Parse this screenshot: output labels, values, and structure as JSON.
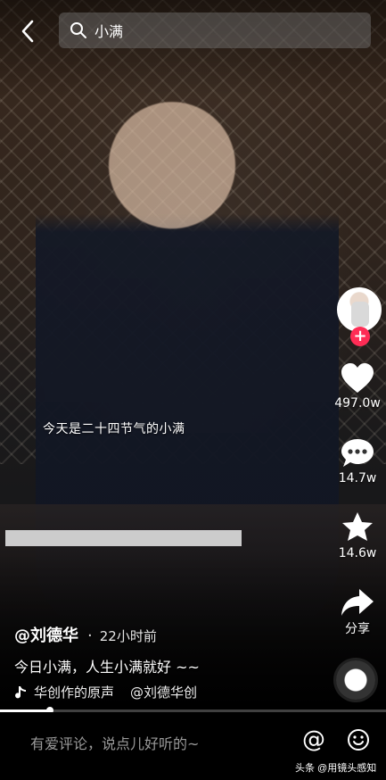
{
  "search": {
    "query": "小满"
  },
  "video": {
    "subtitle": "今天是二十四节气的小满"
  },
  "rail": {
    "likes": "497.0w",
    "comments": "14.7w",
    "favorites": "14.6w",
    "share_label": "分享"
  },
  "post": {
    "author": "@刘德华",
    "separator": "·",
    "time": "22小时前",
    "description": "今日小满，人生小满就好 ~~",
    "music_1": "华创作的原声",
    "music_2": "@刘德华创"
  },
  "progress": {
    "fraction": 0.13
  },
  "comment_bar": {
    "placeholder": "有爱评论，说点儿好听的~",
    "at_symbol": "@",
    "watermark": "头条 @用镜头感知"
  },
  "colors": {
    "accent": "#fe2c55",
    "like": "#ffffff"
  }
}
